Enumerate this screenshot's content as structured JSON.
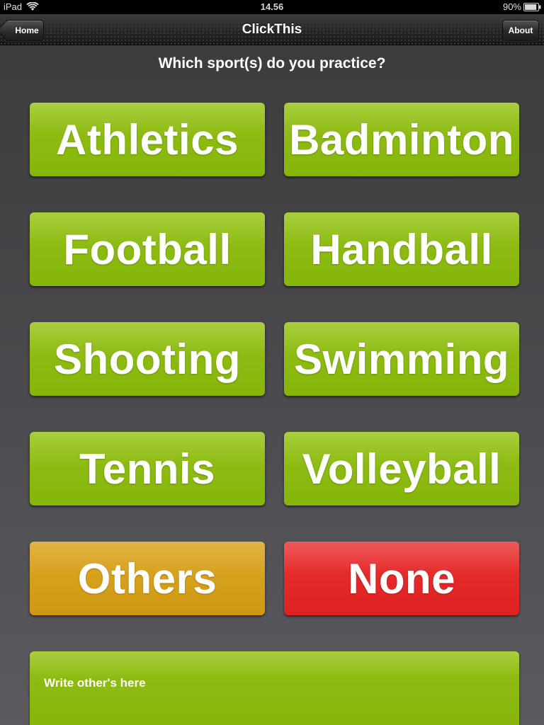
{
  "status_bar": {
    "device": "iPad",
    "time": "14.56",
    "battery": "90%",
    "battery_level": 0.9,
    "wifi_icon": "wifi-icon",
    "battery_icon": "battery-icon"
  },
  "nav": {
    "title": "ClickThis",
    "home_label": "Home",
    "about_label": "About"
  },
  "question": "Which sport(s) do you practice?",
  "options": [
    {
      "label": "Athletics"
    },
    {
      "label": "Badminton"
    },
    {
      "label": "Football"
    },
    {
      "label": "Handball"
    },
    {
      "label": "Shooting"
    },
    {
      "label": "Swimming"
    },
    {
      "label": "Tennis"
    },
    {
      "label": "Volleyball"
    },
    {
      "label": "Others"
    },
    {
      "label": "None"
    }
  ],
  "others_field": {
    "placeholder": "Write other's here",
    "value": ""
  },
  "colors": {
    "green": "#8dbb12",
    "orange": "#d6a11d",
    "red": "#e42a2a",
    "background": "#4b4b4f"
  }
}
